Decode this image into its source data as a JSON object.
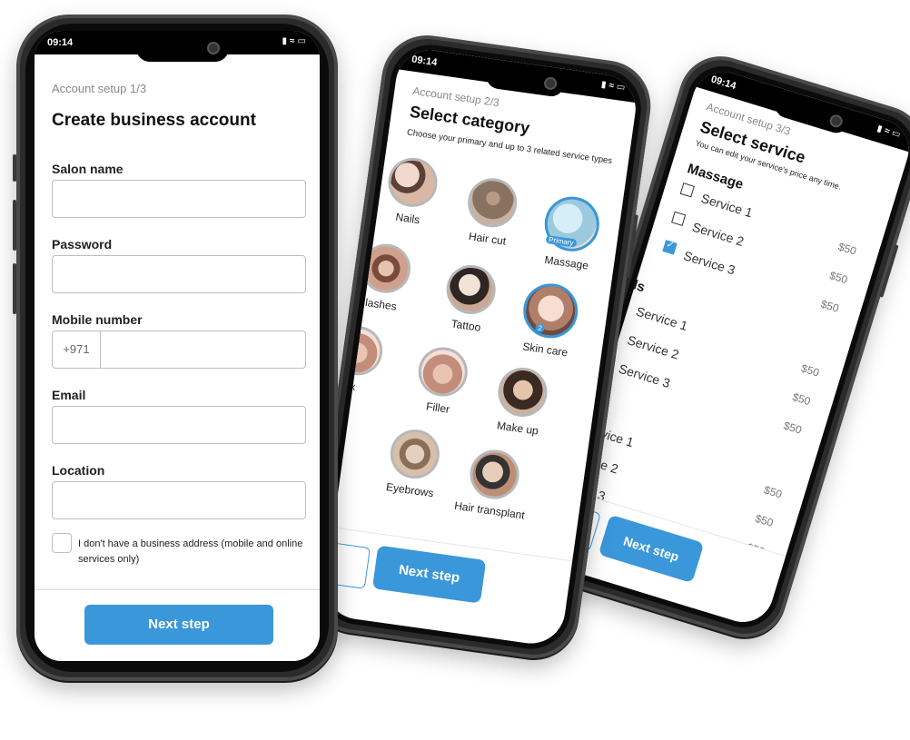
{
  "phone1": {
    "time": "09:14",
    "step": "Account setup 1/3",
    "title": "Create business account",
    "fields": {
      "salon_name": {
        "label": "Salon name",
        "value": ""
      },
      "password": {
        "label": "Password",
        "value": ""
      },
      "mobile": {
        "label": "Mobile number",
        "prefix": "+971",
        "value": ""
      },
      "email": {
        "label": "Email",
        "value": ""
      },
      "location": {
        "label": "Location",
        "value": ""
      }
    },
    "no_address_label": "I don't have a business address (mobile and online services only)",
    "next_label": "Next step"
  },
  "phone2": {
    "time": "09:14",
    "step": "Account setup 2/3",
    "title": "Select category",
    "subtitle": "Choose your primary and up to 3 related service types",
    "categories": [
      {
        "label": "Nails"
      },
      {
        "label": "Hair cut"
      },
      {
        "label": "Massage",
        "badge": "Primary",
        "selected": true
      },
      {
        "label": "lashes"
      },
      {
        "label": "Tattoo"
      },
      {
        "label": "Skin care",
        "badge": "2",
        "selected": true
      },
      {
        "label": "x"
      },
      {
        "label": "Filler"
      },
      {
        "label": "Make up"
      },
      {
        "label": "Eyebrows"
      },
      {
        "label": "Hair transplant"
      }
    ],
    "next_label": "Next step"
  },
  "phone3": {
    "time": "09:14",
    "step": "Account setup 3/3",
    "title": "Select service",
    "subtitle": "You can edit your service's price any time.",
    "groups": [
      {
        "name": "Massage",
        "services": [
          {
            "name": "Service 1",
            "price": "$50",
            "checked": false
          },
          {
            "name": "Service 2",
            "price": "$50",
            "checked": false
          },
          {
            "name": "Service 3",
            "price": "$50",
            "checked": true
          }
        ]
      },
      {
        "name": "ails",
        "services": [
          {
            "name": "Service 1",
            "price": "$50",
            "checked": false
          },
          {
            "name": "Service 2",
            "price": "$50",
            "checked": false
          },
          {
            "name": "Service 3",
            "price": "$50",
            "checked": false
          }
        ]
      },
      {
        "name": "shes",
        "services": [
          {
            "name": "ervice 1",
            "price": "$50",
            "checked": false
          },
          {
            "name": "rvice 2",
            "price": "$50",
            "checked": false
          },
          {
            "name": "vice 3",
            "price": "$50",
            "checked": false
          }
        ]
      }
    ],
    "next_label": "Next step"
  },
  "colors": {
    "accent": "#3a97d9",
    "border": "#bdbdbd",
    "muted": "#888888"
  },
  "icons": [
    "signal-icon",
    "wifi-icon",
    "battery-icon",
    "camera-icon",
    "checkbox-icon"
  ]
}
